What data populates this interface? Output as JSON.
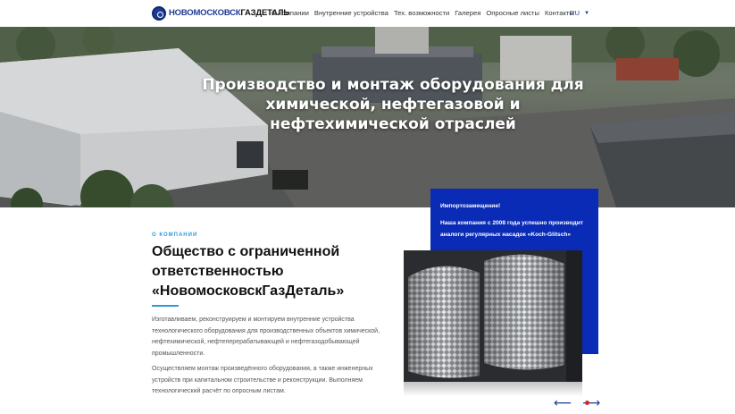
{
  "header": {
    "logo_part1": "НОВОМОСКОВСК",
    "logo_part2": "ГАЗДЕТАЛЬ",
    "nav": [
      {
        "label": "О компании"
      },
      {
        "label": "Внутренние устройства"
      },
      {
        "label": "Тех. возможности"
      },
      {
        "label": "Галерея"
      },
      {
        "label": "Опросные листы"
      },
      {
        "label": "Контакты"
      }
    ],
    "language": "RU",
    "language_icon": "caret-down-icon"
  },
  "hero": {
    "title": "Производство и монтаж оборудования для химической, нефтегазовой и нефтехимической отраслей"
  },
  "about": {
    "label": "О КОМПАНИИ",
    "heading": "Общество с ограниченной ответственностью «НовомосковскГазДеталь»",
    "paragraph1": "Изготавливаем, реконструируем и монтируем внутренние устройства технологического оборудования для производственных объектов химической, нефтехимической, нефтеперерабатывающей и нефтегазодобывающей промышленности.",
    "paragraph2": "Осуществляем монтаж произведённого оборудования, а также инженерных устройств при капитальном строительстве и реконструкции. Выполняем технологический расчёт по опросным листам."
  },
  "card": {
    "heading": "Импортозамещение!",
    "text": "Наша компания с 2008 года успешно производит аналоги регулярных насадок «Koch-Glitsch»"
  },
  "slider": {
    "prev_icon": "arrow-left-icon",
    "next_icon": "arrow-right-icon",
    "prev": "⟵",
    "next": "⟶"
  },
  "colors": {
    "accent": "#2d9bd8",
    "brand_blue": "#0a2bb5",
    "logo_blue": "#1f3a93"
  }
}
